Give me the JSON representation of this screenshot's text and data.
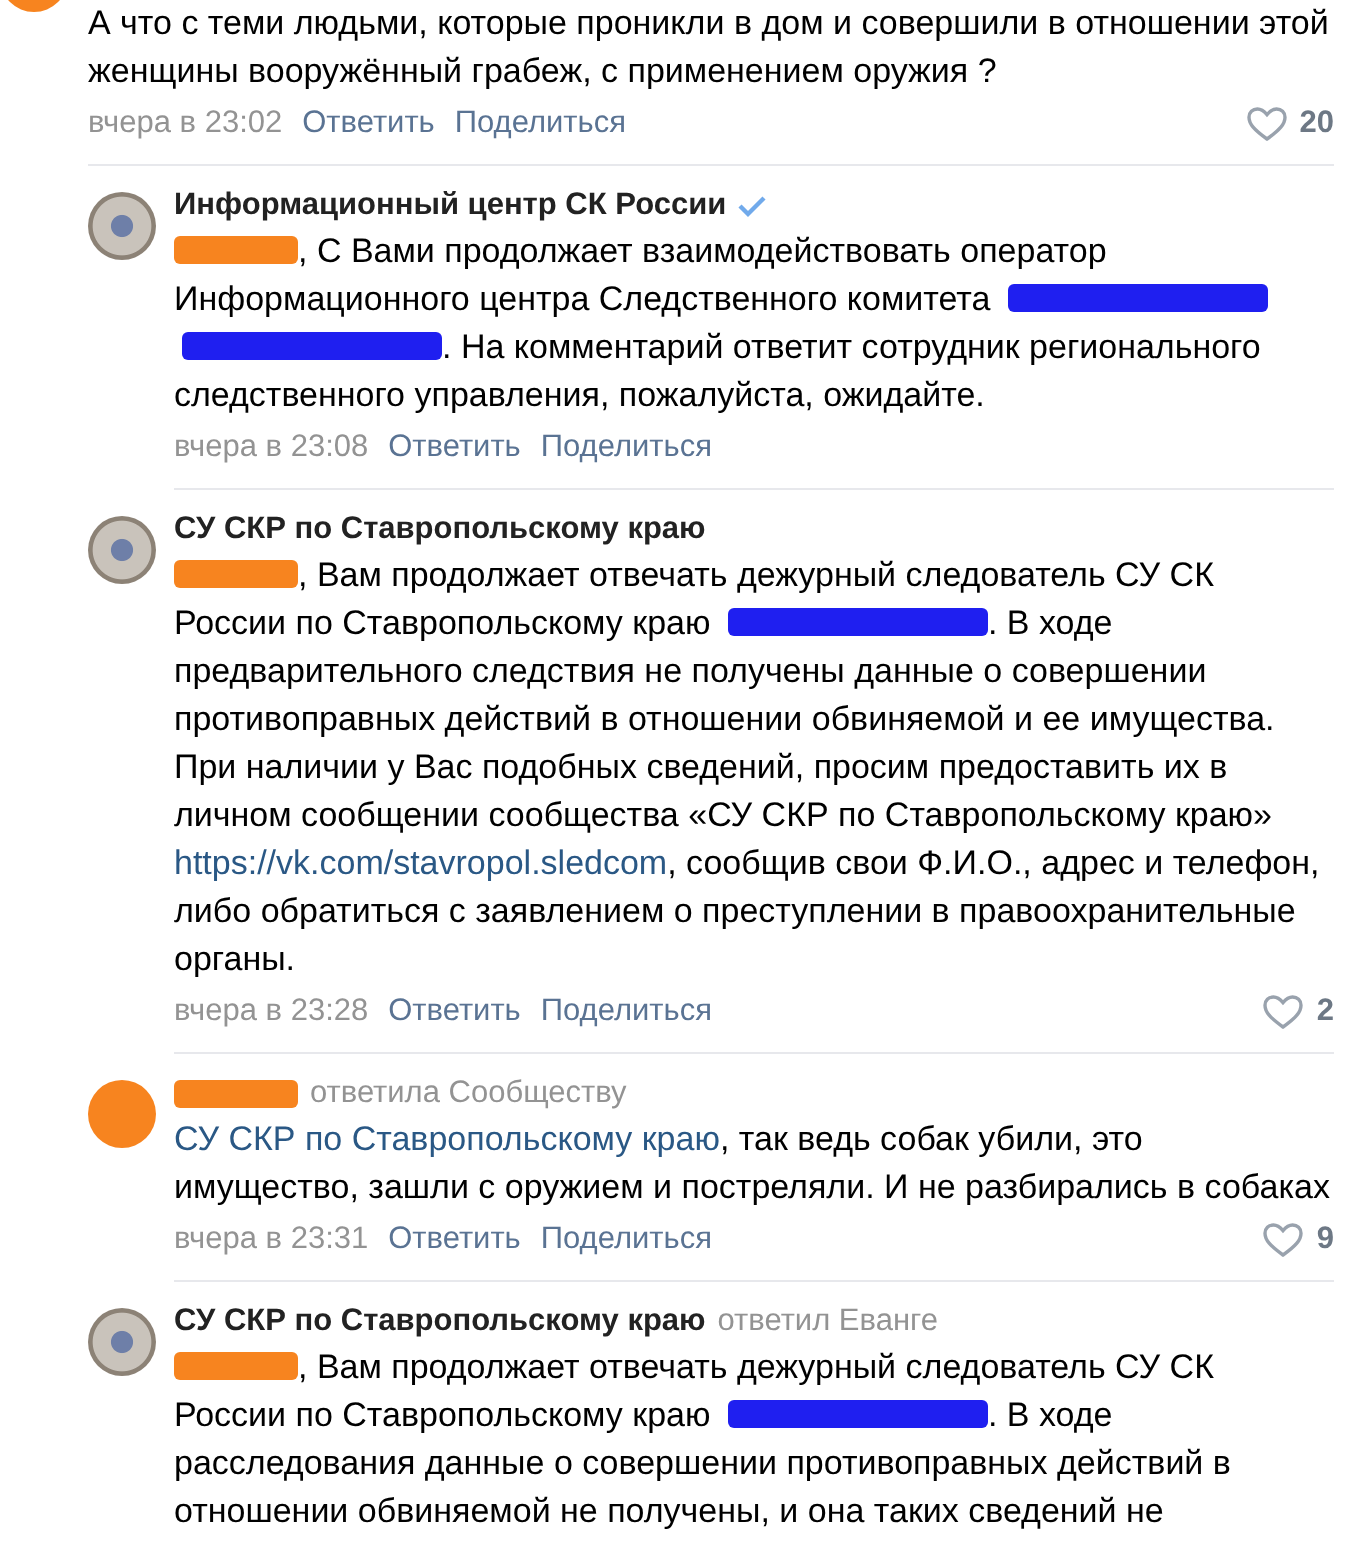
{
  "comment": {
    "avatar": {
      "kind": "redacted",
      "color": "#f7841f"
    },
    "body": [
      {
        "kind": "text",
        "text": "А что с теми людьми, которые проникли в дом и совершили в отношении этой женщины вооружённый грабеж, с применением оружия ?"
      }
    ],
    "date": "вчера в 23:02",
    "reply": "Ответить",
    "share": "Поделиться",
    "likes": "20",
    "replies": [
      {
        "avatar": {
          "kind": "emblem"
        },
        "verified": true,
        "author_parts": [
          {
            "kind": "name",
            "text": "Информационный центр СК России"
          }
        ],
        "body": [
          {
            "kind": "redaction",
            "color": "#f7841f"
          },
          {
            "kind": "text",
            "text": ", С Вами продолжает взаимодействовать оператор Информационного центра Следственного комитета "
          },
          {
            "kind": "redaction",
            "color": "#1f1ff0"
          },
          {
            "kind": "redaction",
            "color": "#1f1ff0"
          },
          {
            "kind": "text",
            "text": ". На комментарий ответит сотрудник регионального следственного управления, пожалуйста, ожидайте."
          }
        ],
        "date": "вчера в 23:08",
        "reply": "Ответить",
        "share": "Поделиться"
      },
      {
        "avatar": {
          "kind": "emblem"
        },
        "author_parts": [
          {
            "kind": "name",
            "text": "СУ СКР по Ставропольскому краю"
          }
        ],
        "body": [
          {
            "kind": "redaction",
            "color": "#f7841f"
          },
          {
            "kind": "text",
            "text": ", Вам продолжает отвечать дежурный следователь СУ СК России по Ставропольскому краю "
          },
          {
            "kind": "redaction",
            "color": "#1f1ff0"
          },
          {
            "kind": "text",
            "text": ". В ходе предварительного следствия не получены данные о совершении противоправных действий в отношении обвиняемой и ее имущества. При наличии у Вас подобных сведений, просим предоставить их в личном сообщении сообщества «СУ СКР по Ставропольскому краю» "
          },
          {
            "kind": "link",
            "text": "https://vk.com/stavropol.sledcom"
          },
          {
            "kind": "text",
            "text": ", сообщив свои Ф.И.О., адрес и телефон, либо обратиться с заявлением о преступлении в правоохранительные органы."
          }
        ],
        "date": "вчера в 23:28",
        "reply": "Ответить",
        "share": "Поделиться",
        "likes": "2"
      },
      {
        "avatar": {
          "kind": "redacted",
          "color": "#f7841f"
        },
        "author_parts": [
          {
            "kind": "redaction",
            "color": "#f7841f"
          },
          {
            "kind": "replied",
            "text": "ответила Сообществу"
          }
        ],
        "body": [
          {
            "kind": "link",
            "text": "СУ СКР по Ставропольскому краю"
          },
          {
            "kind": "text",
            "text": ", так ведь собак убили, это имущество, зашли с оружием и постреляли. И не разбирались в собаках"
          }
        ],
        "date": "вчера в 23:31",
        "reply": "Ответить",
        "share": "Поделиться",
        "likes": "9"
      },
      {
        "avatar": {
          "kind": "emblem"
        },
        "author_parts": [
          {
            "kind": "name",
            "text": "СУ СКР по Ставропольскому краю"
          },
          {
            "kind": "replied",
            "text": "ответил Еванге"
          }
        ],
        "body": [
          {
            "kind": "redaction",
            "color": "#f7841f"
          },
          {
            "kind": "text",
            "text": ", Вам продолжает отвечать дежурный следователь СУ СК России по Ставропольскому краю "
          },
          {
            "kind": "redaction",
            "color": "#1f1ff0"
          },
          {
            "kind": "text",
            "text": ". В ходе расследования данные о совершении противоправных действий в отношении обвиняемой не получены, и она таких сведений не"
          }
        ]
      }
    ]
  }
}
